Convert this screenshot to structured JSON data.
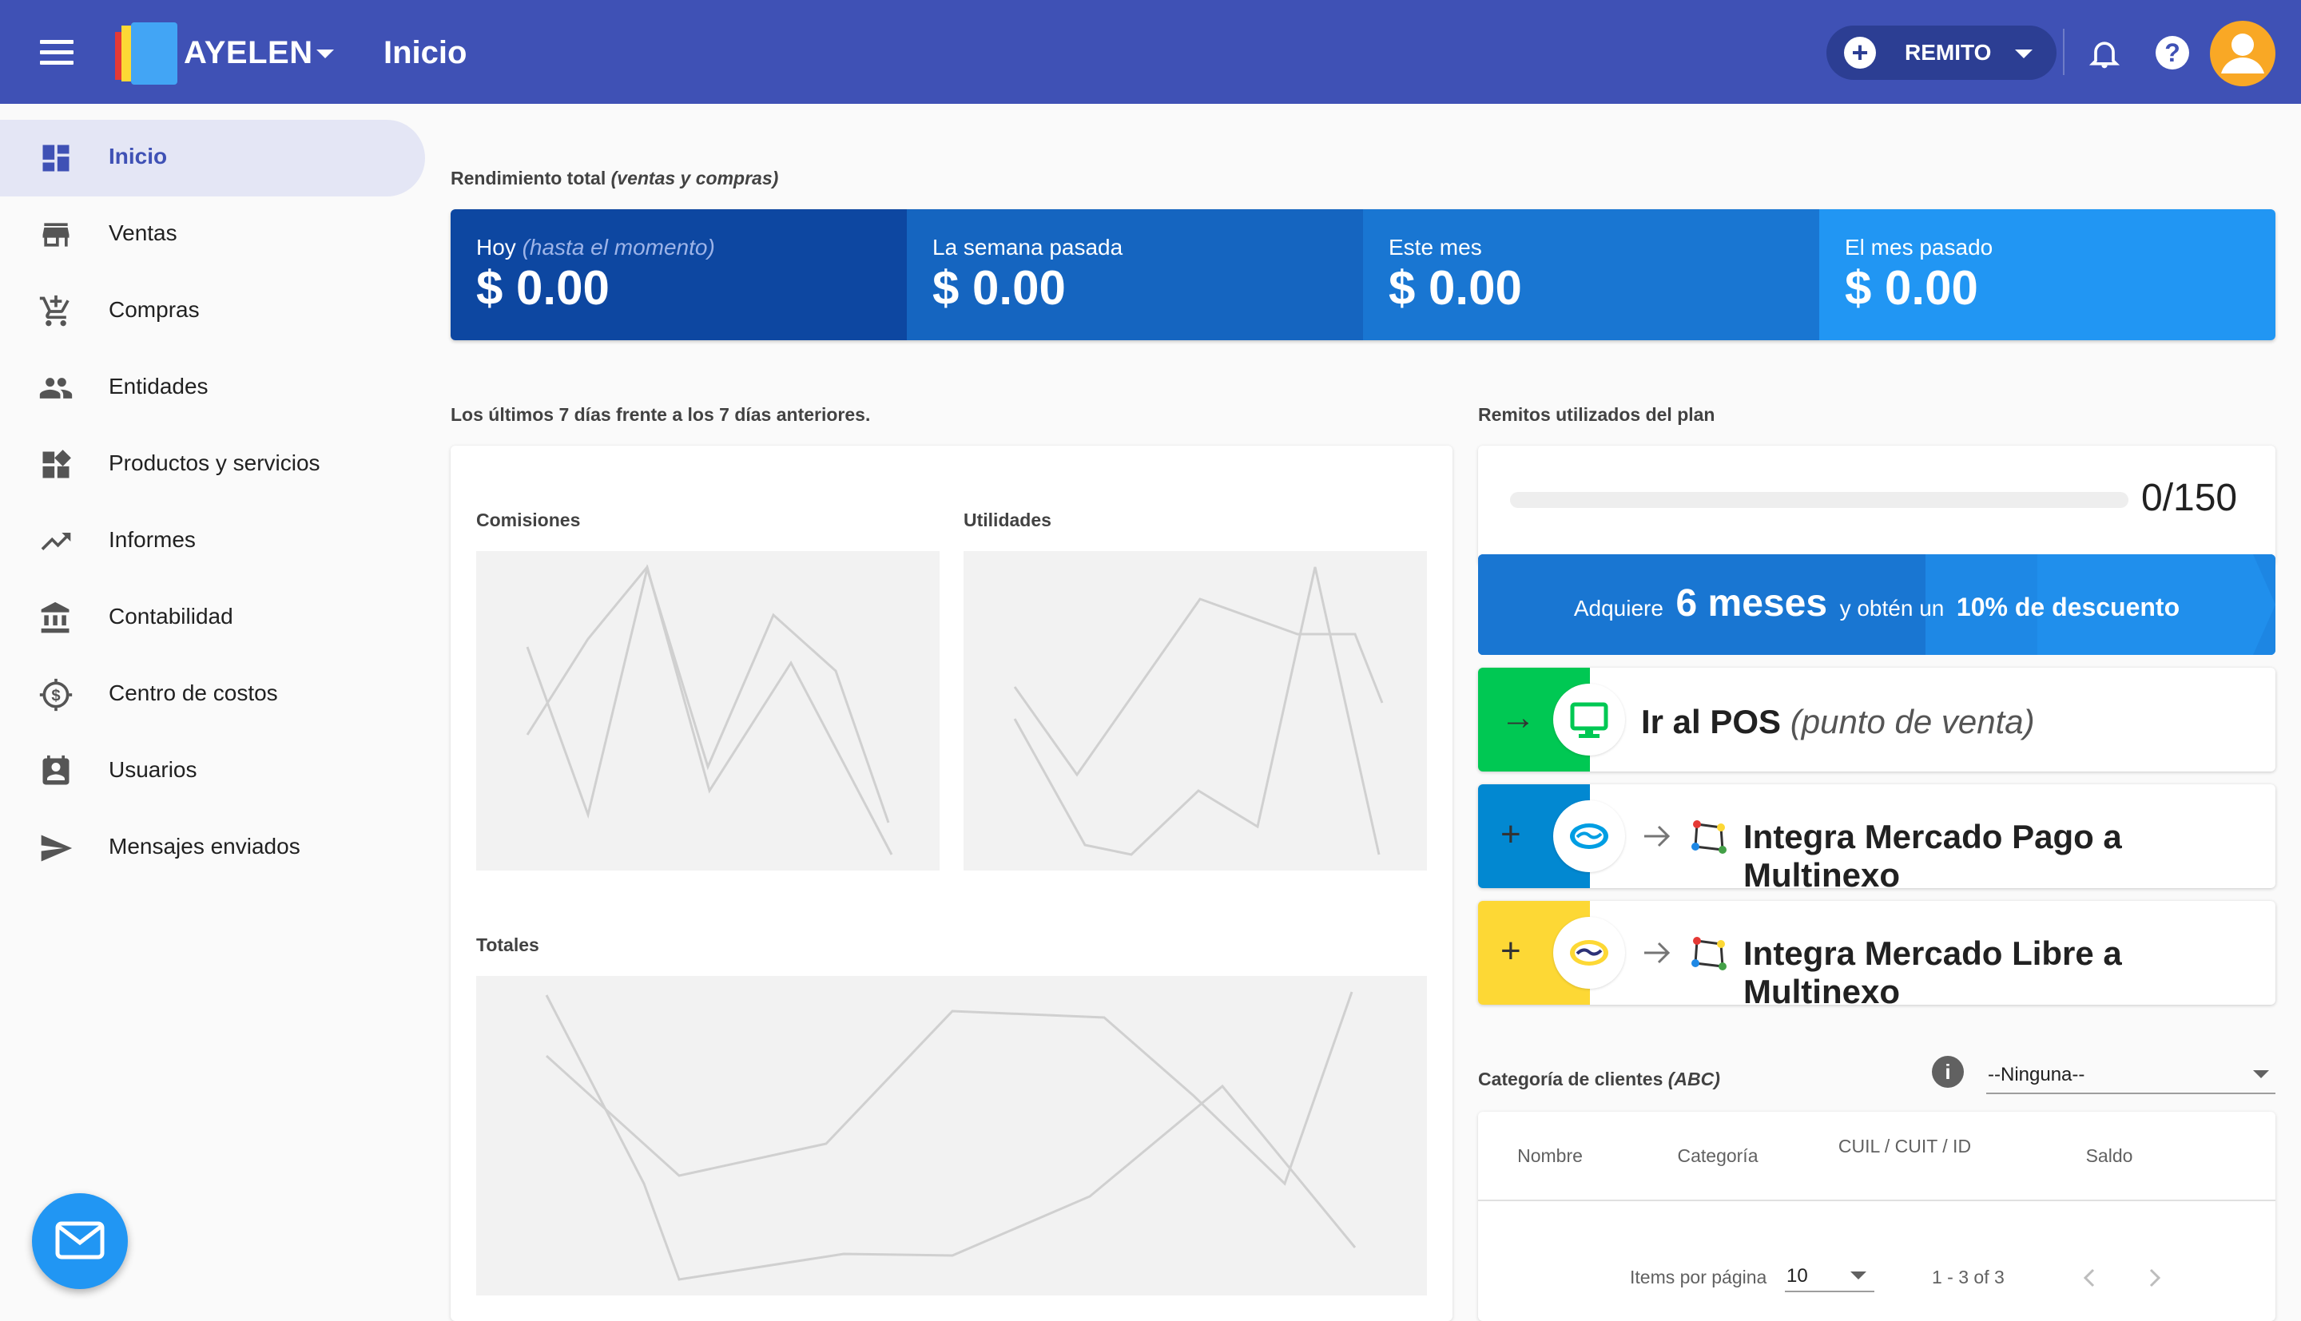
{
  "header": {
    "company": "AYELEN",
    "title": "Inicio",
    "action_button": "REMITO",
    "icons": {
      "menu": "menu-icon",
      "bell": "bell-icon",
      "help": "help-icon",
      "avatar": "user-avatar-icon"
    }
  },
  "sidebar": {
    "items": [
      {
        "label": "Inicio",
        "icon": "dashboard-icon",
        "active": true
      },
      {
        "label": "Ventas",
        "icon": "store-icon"
      },
      {
        "label": "Compras",
        "icon": "cart-add-icon"
      },
      {
        "label": "Entidades",
        "icon": "people-icon"
      },
      {
        "label": "Productos y servicios",
        "icon": "widgets-icon"
      },
      {
        "label": "Informes",
        "icon": "trending-up-icon"
      },
      {
        "label": "Contabilidad",
        "icon": "bank-icon"
      },
      {
        "label": "Centro de costos",
        "icon": "cost-center-icon"
      },
      {
        "label": "Usuarios",
        "icon": "user-badge-icon"
      },
      {
        "label": "Mensajes enviados",
        "icon": "send-icon"
      }
    ]
  },
  "performance": {
    "label": "Rendimiento total",
    "label_note": "(ventas y compras)",
    "kpis": [
      {
        "title": "Hoy",
        "note": "(hasta el momento)",
        "value": "$ 0.00",
        "color": "#0d47a1"
      },
      {
        "title": "La semana pasada",
        "value": "$ 0.00",
        "color": "#1565c0"
      },
      {
        "title": "Este mes",
        "value": "$ 0.00",
        "color": "#1976d2"
      },
      {
        "title": "El mes pasado",
        "value": "$ 0.00",
        "color": "#2196f3"
      }
    ]
  },
  "comparison": {
    "label": "Los últimos 7 días frente a los 7 días anteriores.",
    "charts": {
      "commissions": "Comisiones",
      "profits": "Utilidades",
      "totals": "Totales"
    }
  },
  "plan": {
    "label": "Remitos utilizados del plan",
    "used": 0,
    "total": 150,
    "count_text": "0/150"
  },
  "promo": {
    "prefix": "Adquiere",
    "months": "6 meses",
    "middle": "y obtén un",
    "discount": "10% de descuento"
  },
  "actions": [
    {
      "title": "Ir al POS",
      "note": "(punto de venta)",
      "color": "#00c853",
      "symbol": "→",
      "icon": "monitor-icon"
    },
    {
      "title": "Integra Mercado Pago a Multinexo",
      "color": "#0288d1",
      "symbol": "+",
      "icon": "mercado-pago-icon"
    },
    {
      "title": "Integra Mercado Libre a Multinexo",
      "color": "#fdd835",
      "symbol": "+",
      "icon": "mercado-libre-icon"
    }
  ],
  "clients": {
    "label": "Categoría de clientes",
    "label_note": "(ABC)",
    "select_value": "--Ninguna--",
    "columns": [
      "Nombre",
      "Categoría",
      "CUIL / CUIT / ID",
      "Saldo"
    ],
    "pagination": {
      "items_label": "Items por página",
      "page_size": "10",
      "range": "1 - 3 of 3"
    }
  },
  "colors": {
    "primary": "#3f51b5",
    "fab": "#2196f3"
  }
}
